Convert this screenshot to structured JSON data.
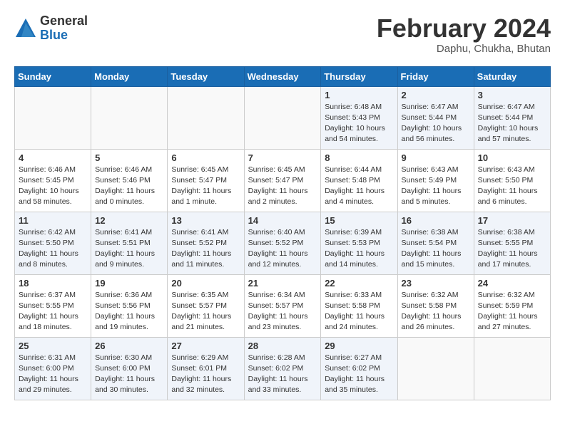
{
  "logo": {
    "general": "General",
    "blue": "Blue"
  },
  "title": "February 2024",
  "subtitle": "Daphu, Chukha, Bhutan",
  "headers": [
    "Sunday",
    "Monday",
    "Tuesday",
    "Wednesday",
    "Thursday",
    "Friday",
    "Saturday"
  ],
  "weeks": [
    [
      {
        "day": "",
        "info": ""
      },
      {
        "day": "",
        "info": ""
      },
      {
        "day": "",
        "info": ""
      },
      {
        "day": "",
        "info": ""
      },
      {
        "day": "1",
        "info": "Sunrise: 6:48 AM\nSunset: 5:43 PM\nDaylight: 10 hours\nand 54 minutes."
      },
      {
        "day": "2",
        "info": "Sunrise: 6:47 AM\nSunset: 5:44 PM\nDaylight: 10 hours\nand 56 minutes."
      },
      {
        "day": "3",
        "info": "Sunrise: 6:47 AM\nSunset: 5:44 PM\nDaylight: 10 hours\nand 57 minutes."
      }
    ],
    [
      {
        "day": "4",
        "info": "Sunrise: 6:46 AM\nSunset: 5:45 PM\nDaylight: 10 hours\nand 58 minutes."
      },
      {
        "day": "5",
        "info": "Sunrise: 6:46 AM\nSunset: 5:46 PM\nDaylight: 11 hours\nand 0 minutes."
      },
      {
        "day": "6",
        "info": "Sunrise: 6:45 AM\nSunset: 5:47 PM\nDaylight: 11 hours\nand 1 minute."
      },
      {
        "day": "7",
        "info": "Sunrise: 6:45 AM\nSunset: 5:47 PM\nDaylight: 11 hours\nand 2 minutes."
      },
      {
        "day": "8",
        "info": "Sunrise: 6:44 AM\nSunset: 5:48 PM\nDaylight: 11 hours\nand 4 minutes."
      },
      {
        "day": "9",
        "info": "Sunrise: 6:43 AM\nSunset: 5:49 PM\nDaylight: 11 hours\nand 5 minutes."
      },
      {
        "day": "10",
        "info": "Sunrise: 6:43 AM\nSunset: 5:50 PM\nDaylight: 11 hours\nand 6 minutes."
      }
    ],
    [
      {
        "day": "11",
        "info": "Sunrise: 6:42 AM\nSunset: 5:50 PM\nDaylight: 11 hours\nand 8 minutes."
      },
      {
        "day": "12",
        "info": "Sunrise: 6:41 AM\nSunset: 5:51 PM\nDaylight: 11 hours\nand 9 minutes."
      },
      {
        "day": "13",
        "info": "Sunrise: 6:41 AM\nSunset: 5:52 PM\nDaylight: 11 hours\nand 11 minutes."
      },
      {
        "day": "14",
        "info": "Sunrise: 6:40 AM\nSunset: 5:52 PM\nDaylight: 11 hours\nand 12 minutes."
      },
      {
        "day": "15",
        "info": "Sunrise: 6:39 AM\nSunset: 5:53 PM\nDaylight: 11 hours\nand 14 minutes."
      },
      {
        "day": "16",
        "info": "Sunrise: 6:38 AM\nSunset: 5:54 PM\nDaylight: 11 hours\nand 15 minutes."
      },
      {
        "day": "17",
        "info": "Sunrise: 6:38 AM\nSunset: 5:55 PM\nDaylight: 11 hours\nand 17 minutes."
      }
    ],
    [
      {
        "day": "18",
        "info": "Sunrise: 6:37 AM\nSunset: 5:55 PM\nDaylight: 11 hours\nand 18 minutes."
      },
      {
        "day": "19",
        "info": "Sunrise: 6:36 AM\nSunset: 5:56 PM\nDaylight: 11 hours\nand 19 minutes."
      },
      {
        "day": "20",
        "info": "Sunrise: 6:35 AM\nSunset: 5:57 PM\nDaylight: 11 hours\nand 21 minutes."
      },
      {
        "day": "21",
        "info": "Sunrise: 6:34 AM\nSunset: 5:57 PM\nDaylight: 11 hours\nand 23 minutes."
      },
      {
        "day": "22",
        "info": "Sunrise: 6:33 AM\nSunset: 5:58 PM\nDaylight: 11 hours\nand 24 minutes."
      },
      {
        "day": "23",
        "info": "Sunrise: 6:32 AM\nSunset: 5:58 PM\nDaylight: 11 hours\nand 26 minutes."
      },
      {
        "day": "24",
        "info": "Sunrise: 6:32 AM\nSunset: 5:59 PM\nDaylight: 11 hours\nand 27 minutes."
      }
    ],
    [
      {
        "day": "25",
        "info": "Sunrise: 6:31 AM\nSunset: 6:00 PM\nDaylight: 11 hours\nand 29 minutes."
      },
      {
        "day": "26",
        "info": "Sunrise: 6:30 AM\nSunset: 6:00 PM\nDaylight: 11 hours\nand 30 minutes."
      },
      {
        "day": "27",
        "info": "Sunrise: 6:29 AM\nSunset: 6:01 PM\nDaylight: 11 hours\nand 32 minutes."
      },
      {
        "day": "28",
        "info": "Sunrise: 6:28 AM\nSunset: 6:02 PM\nDaylight: 11 hours\nand 33 minutes."
      },
      {
        "day": "29",
        "info": "Sunrise: 6:27 AM\nSunset: 6:02 PM\nDaylight: 11 hours\nand 35 minutes."
      },
      {
        "day": "",
        "info": ""
      },
      {
        "day": "",
        "info": ""
      }
    ]
  ]
}
